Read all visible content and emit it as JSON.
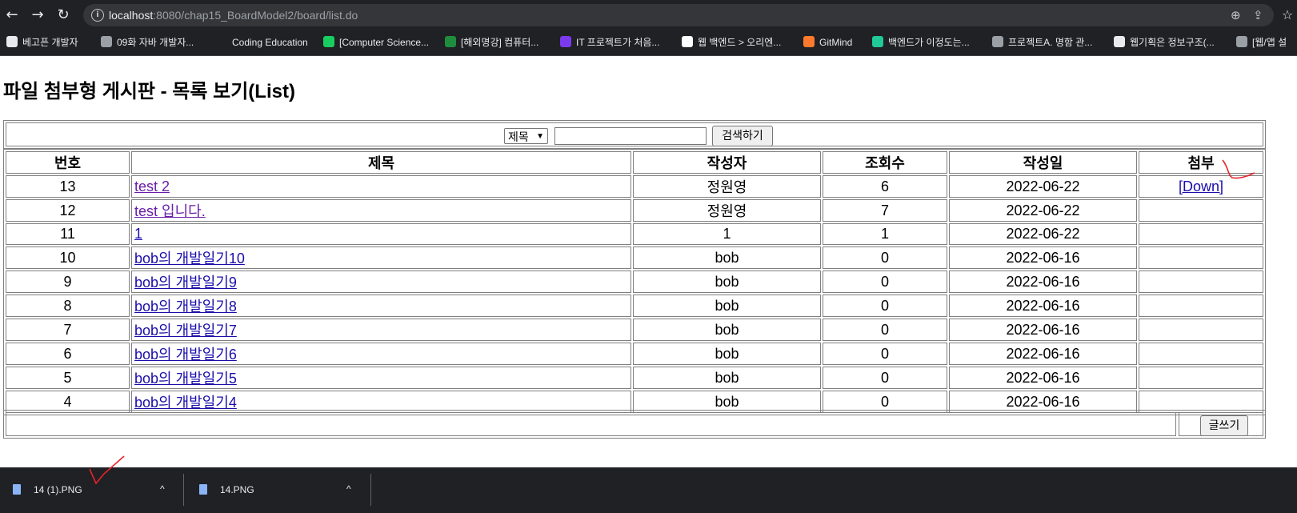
{
  "browser": {
    "url_host": "localhost",
    "url_rest": ":8080/chap15_BoardModel2/board/list.do",
    "bookmarks": [
      {
        "label": "베고픈 개발자",
        "color": "#e8eaed"
      },
      {
        "label": "09화 자바 개발자...",
        "color": "#9aa0a6"
      },
      {
        "label": "Coding Education",
        "color": "#202124"
      },
      {
        "label": "[Computer Science...",
        "color": "#19ce60"
      },
      {
        "label": "[해외명강] 컴퓨터...",
        "color": "#1e8e3e"
      },
      {
        "label": "IT 프로젝트가 처음...",
        "color": "#7c3aed"
      },
      {
        "label": "웹 백엔드 > 오리엔...",
        "color": "#ffffff"
      },
      {
        "label": "GitMind",
        "color": "#ff7a2e"
      },
      {
        "label": "백엔드가 이정도는...",
        "color": "#20c997"
      },
      {
        "label": "프로젝트A. 명함 관...",
        "color": "#9aa0a6"
      },
      {
        "label": "웹기획은 정보구조(...",
        "color": "#e8eaed"
      },
      {
        "label": "[웹/앱 설",
        "color": "#9aa0a6"
      }
    ]
  },
  "page": {
    "title": "파일 첨부형 게시판 - 목록 보기(List)"
  },
  "search": {
    "selected_option": "제목",
    "query_value": "",
    "button_label": "검색하기"
  },
  "table": {
    "headers": [
      "번호",
      "제목",
      "작성자",
      "조회수",
      "작성일",
      "첨부"
    ],
    "rows": [
      {
        "num": "13",
        "title": "test 2",
        "author": "정원영",
        "views": "6",
        "date": "2022-06-22",
        "attach": "[Down]"
      },
      {
        "num": "12",
        "title": "test 입니다.",
        "author": "정원영",
        "views": "7",
        "date": "2022-06-22",
        "attach": ""
      },
      {
        "num": "11",
        "title": "1",
        "author": "1",
        "views": "1",
        "date": "2022-06-22",
        "attach": ""
      },
      {
        "num": "10",
        "title": "bob의 개발일기10",
        "author": "bob",
        "views": "0",
        "date": "2022-06-16",
        "attach": ""
      },
      {
        "num": "9",
        "title": "bob의 개발일기9",
        "author": "bob",
        "views": "0",
        "date": "2022-06-16",
        "attach": ""
      },
      {
        "num": "8",
        "title": "bob의 개발일기8",
        "author": "bob",
        "views": "0",
        "date": "2022-06-16",
        "attach": ""
      },
      {
        "num": "7",
        "title": "bob의 개발일기7",
        "author": "bob",
        "views": "0",
        "date": "2022-06-16",
        "attach": ""
      },
      {
        "num": "6",
        "title": "bob의 개발일기6",
        "author": "bob",
        "views": "0",
        "date": "2022-06-16",
        "attach": ""
      },
      {
        "num": "5",
        "title": "bob의 개발일기5",
        "author": "bob",
        "views": "0",
        "date": "2022-06-16",
        "attach": ""
      },
      {
        "num": "4",
        "title": "bob의 개발일기4",
        "author": "bob",
        "views": "0",
        "date": "2022-06-16",
        "attach": ""
      }
    ]
  },
  "footer": {
    "write_button_label": "글쓰기"
  },
  "downloads": [
    {
      "name": "14 (1).PNG"
    },
    {
      "name": "14.PNG"
    }
  ],
  "colors": {
    "link": "#1a0dab",
    "visited_link": "#681da8",
    "annotation": "#e8232b",
    "chrome_bg": "#202124"
  }
}
